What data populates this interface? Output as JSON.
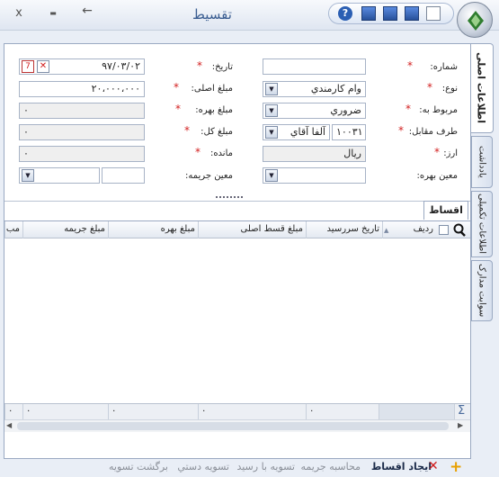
{
  "window": {
    "title": "تقسيط",
    "close": "x",
    "minimize": "▬",
    "back": "←"
  },
  "tabs": {
    "vertical": [
      "اطلاعات اصلی",
      "یادداشت",
      "اطلاعات تکمیلی",
      "سوابت مدارک"
    ],
    "inner": "اقساط"
  },
  "form": {
    "shomare": {
      "label": "شماره:",
      "value": ""
    },
    "tarikh": {
      "label": "تاریخ:",
      "value": "۹۷/۰۳/۰۲"
    },
    "noe": {
      "label": "نوع:",
      "value": "وام کارمندي"
    },
    "mablagh_asli": {
      "label": "مبلغ اصلی:",
      "value": "۲۰،۰۰۰،۰۰۰"
    },
    "marbut_be": {
      "label": "مربوط به:",
      "value": "ضروري"
    },
    "mablagh_bahre": {
      "label": "مبلغ بهره:",
      "value": "۰"
    },
    "taraf": {
      "label": "طرف مقابل:",
      "code": "۱۰۰۳۱",
      "name": "آلفا آقاي"
    },
    "mablagh_kol": {
      "label": "مبلغ کل:",
      "value": "۰"
    },
    "arz": {
      "label": "ارز:",
      "value": "ريال"
    },
    "mande": {
      "label": "مانده:",
      "value": "۰"
    },
    "moin_bahre": {
      "label": "معین بهره:",
      "value": ""
    },
    "moin_jarime": {
      "label": "معین جریمه:",
      "value": ""
    }
  },
  "grid": {
    "columns": [
      "ردیف",
      "تاریخ سررسید",
      "مبلغ قسط اصلی",
      "مبلغ بهره",
      "مبلغ جریمه",
      "مب"
    ],
    "footer": [
      "۰",
      "۰",
      "۰",
      "۰",
      "۰"
    ],
    "sigma": "Σ"
  },
  "actions": {
    "add": "ایجاد اقساط",
    "calc": "محاسبه جریمه",
    "settle_receipt": "تسویه با رسید",
    "settle_manual": "تسویه دستي",
    "undo": "برگشت تسویه"
  },
  "colors": {
    "accent": "#3a5d91",
    "required": "#d21f1f",
    "add": "#e8a000",
    "delete": "#d21f1f"
  }
}
